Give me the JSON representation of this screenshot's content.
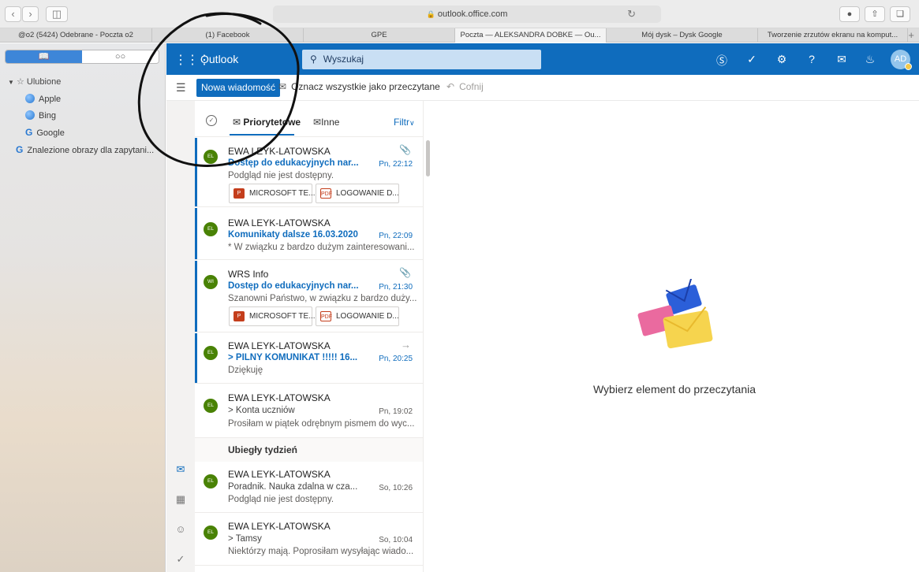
{
  "browser": {
    "address": "outlook.office.com",
    "tabs": [
      "@o2 (5424) Odebrane - Poczta o2",
      "(1) Facebook",
      "GPE",
      "Poczta — ALEKSANDRA DOBKE — Ou...",
      "Mój dysk – Dysk Google",
      "Tworzenie zrzutów ekranu na komput..."
    ],
    "active_tab_index": 3
  },
  "safari_sidebar": {
    "favorites_header": "Ulubione",
    "items": [
      "Apple",
      "Bing",
      "Google"
    ],
    "extra_item": "Znalezione obrazy dla zapytani..."
  },
  "outlook": {
    "app_name": "Outlook",
    "search_placeholder": "Wyszukaj",
    "avatar_initials": "AD",
    "new_message": "Nowa wiadomość",
    "mark_all_read": "Oznacz wszystkie jako przeczytane",
    "undo": "Cofnij",
    "tabs": {
      "focused": "Priorytetowe",
      "other": "Inne",
      "filter": "Filtr"
    },
    "section_last_week": "Ubiegły tydzień",
    "reading_pane_empty": "Wybierz element do przeczytania",
    "accent_color": "#0f6cbd"
  },
  "messages": [
    {
      "initials": "EL",
      "from": "EWA LEYK-LATOWSKA",
      "subject": "Dostęp do edukacyjnych nar...",
      "time": "Pn, 22:12",
      "preview": "Podgląd nie jest dostępny.",
      "unread": true,
      "icon": "paperclip-icon",
      "attachments": [
        "MICROSOFT TE...",
        "LOGOWANIE D..."
      ]
    },
    {
      "initials": "EL",
      "from": "EWA LEYK-LATOWSKA",
      "subject": "Komunikaty dalsze 16.03.2020",
      "time": "Pn, 22:09",
      "preview": "* W związku z bardzo dużym zainteresowani...",
      "unread": true
    },
    {
      "initials": "WI",
      "from": "WRS Info",
      "subject": "Dostęp do edukacyjnych nar...",
      "time": "Pn, 21:30",
      "preview": "Szanowni Państwo, w związku z bardzo duży...",
      "unread": true,
      "icon": "paperclip-icon",
      "attachments": [
        "MICROSOFT TE...",
        "LOGOWANIE D..."
      ]
    },
    {
      "initials": "EL",
      "from": "EWA LEYK-LATOWSKA",
      "subject": "> PILNY KOMUNIKAT !!!!! 16...",
      "time": "Pn, 20:25",
      "preview": "Dziękuję",
      "unread": true,
      "icon": "forward-arrow-icon"
    },
    {
      "initials": "EL",
      "from": "EWA LEYK-LATOWSKA",
      "subject": "> Konta uczniów",
      "time": "Pn, 19:02",
      "preview": "Prosiłam w piątek odrębnym pismem do wyc...",
      "unread": false
    },
    {
      "initials": "EL",
      "from": "EWA LEYK-LATOWSKA",
      "subject": "Poradnik. Nauka zdalna w cza...",
      "time": "So, 10:26",
      "preview": "Podgląd nie jest dostępny.",
      "unread": false
    },
    {
      "initials": "EL",
      "from": "EWA LEYK-LATOWSKA",
      "subject": "> Tamsy",
      "time": "So, 10:04",
      "preview": "Niektórzy mają. Poprosiłam wysyłając wiado...",
      "unread": false
    }
  ]
}
